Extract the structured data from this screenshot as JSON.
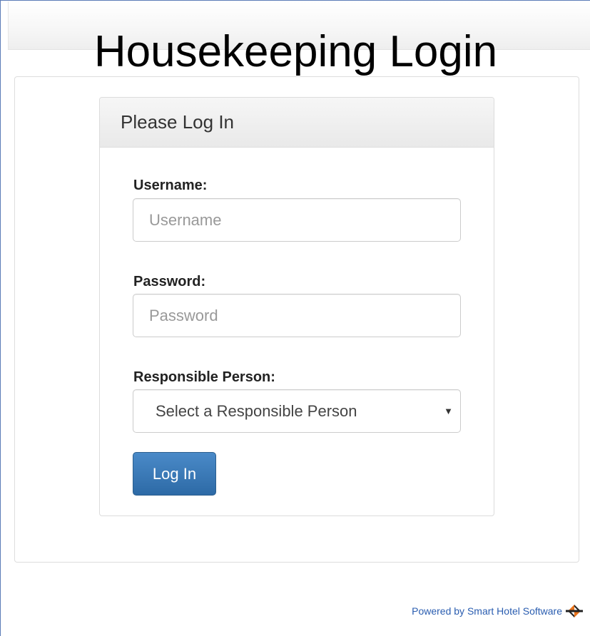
{
  "page": {
    "title": "Housekeeping Login"
  },
  "login_panel": {
    "heading": "Please Log In",
    "username": {
      "label": "Username:",
      "placeholder": "Username",
      "value": ""
    },
    "password": {
      "label": "Password:",
      "placeholder": "Password",
      "value": ""
    },
    "responsible_person": {
      "label": "Responsible Person:",
      "selected": "Select a Responsible Person"
    },
    "submit_label": "Log In"
  },
  "footer": {
    "powered_by": "Powered by Smart Hotel Software",
    "icon": "smart-hotel-logo-icon"
  },
  "colors": {
    "button": "#3276b1",
    "link": "#2a5db0",
    "logo_orange": "#e8731c",
    "logo_dark": "#222222"
  }
}
